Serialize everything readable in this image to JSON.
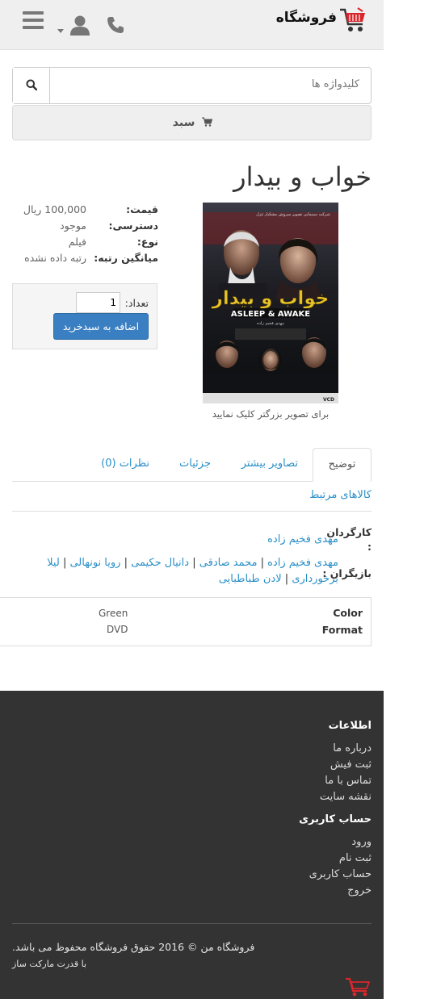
{
  "header": {
    "logo_text": "فروشگاه",
    "icons": [
      "shopping-cart-icon",
      "phone-icon",
      "user-icon",
      "caret-down-icon",
      "hamburger-menu-icon"
    ]
  },
  "search": {
    "placeholder": "کلیدواژه ها"
  },
  "cart": {
    "label": "سبد"
  },
  "product": {
    "title": "خواب و بیدار",
    "poster": {
      "top_text": "شرکت سینمایی تصویر سروش مشکبار غزل",
      "title_fa": "خواب و بیدار",
      "title_en": "ASLEEP & AWAKE",
      "director": "مهدی فخیم زاده",
      "badge": "VCD"
    },
    "image_caption": "برای تصویر بزرگتر کلیک نمایید",
    "info": [
      {
        "label": "قیمت:",
        "value": "100,000 ریال"
      },
      {
        "label": "دسترسی:",
        "value": "موجود"
      },
      {
        "label": "نوع:",
        "value": "فیلم"
      },
      {
        "label": "میانگین رتبه:",
        "value": "رتبه داده نشده"
      }
    ],
    "qty_label": "تعداد:",
    "qty_value": "1",
    "add_button": "اضافه به سبدخرید"
  },
  "tabs": {
    "items": [
      "توضیح",
      "تصاویر بیشتر",
      "جزئیات",
      "نظرات (0)"
    ],
    "second_row": "کالاهای مرتبط"
  },
  "description": {
    "director_label": "کارگردان",
    "director_colon": ":",
    "director_value": "مهدی فخیم زاده",
    "cast_label": "بازیگران :",
    "cast_line1": [
      "مهدی فخیم زاده",
      "محمد صادقی",
      "دانیال حکیمی",
      "رویا نونهالی",
      "لیلا"
    ],
    "cast_line2": [
      "برخورداری",
      "لادن طباطبایی"
    ],
    "separator": "|"
  },
  "specs": [
    {
      "key": "Color",
      "value": "Green"
    },
    {
      "key": "Format",
      "value": "DVD"
    }
  ],
  "footer": {
    "info_heading": "اطلاعات",
    "info_links": [
      "درباره ما",
      "ثبت فیش",
      "تماس با ما",
      "نقشه سایت"
    ],
    "account_heading": "حساب کاربری",
    "account_links": [
      "ورود",
      "ثبت نام",
      "حساب کاربری",
      "خروج"
    ],
    "copyright": "فروشگاه من © 2016 حقوق فروشگاه محفوظ می باشد.",
    "powered_by": "با قدرت مارکت ساز"
  },
  "colors": {
    "link": "#2a8fc7",
    "button": "#3a7fc1",
    "footer_bg": "#333333",
    "logo_cart": "#d9262c"
  }
}
